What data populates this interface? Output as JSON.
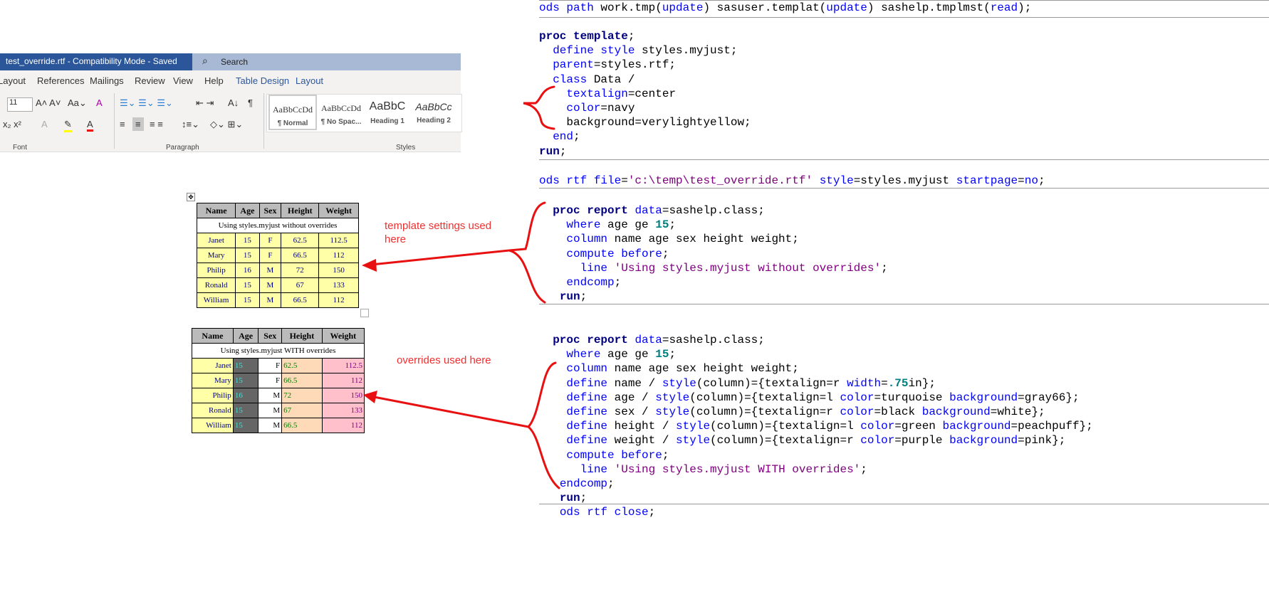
{
  "word": {
    "title": "test_override.rtf  -  Compatibility Mode  -  Saved",
    "search": "Search",
    "tabs": [
      "Layout",
      "References",
      "Mailings",
      "Review",
      "View",
      "Help",
      "Table Design",
      "Layout"
    ],
    "font_size": "11",
    "groups": [
      "Font",
      "Paragraph",
      "Styles"
    ],
    "styles": [
      {
        "preview": "AaBbCcDd",
        "name": "¶ Normal"
      },
      {
        "preview": "AaBbCcDd",
        "name": "¶ No Spac..."
      },
      {
        "preview": "AaBbC",
        "name": "Heading 1"
      },
      {
        "preview": "AaBbCc",
        "name": "Heading 2"
      }
    ]
  },
  "table1": {
    "headers": [
      "Name",
      "Age",
      "Sex",
      "Height",
      "Weight"
    ],
    "subtitle": "Using styles.myjust without overrides",
    "rows": [
      [
        "Janet",
        "15",
        "F",
        "62.5",
        "112.5"
      ],
      [
        "Mary",
        "15",
        "F",
        "66.5",
        "112"
      ],
      [
        "Philip",
        "16",
        "M",
        "72",
        "150"
      ],
      [
        "Ronald",
        "15",
        "M",
        "67",
        "133"
      ],
      [
        "William",
        "15",
        "M",
        "66.5",
        "112"
      ]
    ]
  },
  "table2": {
    "headers": [
      "Name",
      "Age",
      "Sex",
      "Height",
      "Weight"
    ],
    "subtitle": "Using styles.myjust WITH overrides",
    "rows": [
      [
        "Janet",
        "15",
        "F",
        "62.5",
        "112.5"
      ],
      [
        "Mary",
        "15",
        "F",
        "66.5",
        "112"
      ],
      [
        "Philip",
        "16",
        "M",
        "72",
        "150"
      ],
      [
        "Ronald",
        "15",
        "M",
        "67",
        "133"
      ],
      [
        "William",
        "15",
        "M",
        "66.5",
        "112"
      ]
    ]
  },
  "annotations": {
    "template": "template settings used\nhere",
    "overrides": "overrides used here"
  },
  "code": {
    "b1": [
      [
        [
          "ods path",
          "k"
        ],
        [
          " work.tmp(",
          ""
        ],
        [
          "update",
          "k"
        ],
        [
          ") sasuser.templat(",
          ""
        ],
        [
          "update",
          "k"
        ],
        [
          ") sashelp.tmplmst(",
          ""
        ],
        [
          "read",
          "k"
        ],
        [
          ");",
          ""
        ]
      ]
    ],
    "b2": [
      [
        [
          "proc template",
          "b"
        ],
        [
          ";",
          ""
        ]
      ],
      [
        [
          "  ",
          ""
        ],
        [
          "define style",
          "k"
        ],
        [
          " styles.myjust;",
          ""
        ]
      ],
      [
        [
          "  ",
          ""
        ],
        [
          "parent",
          "k"
        ],
        [
          "=styles.rtf;",
          ""
        ]
      ],
      [
        [
          "  ",
          ""
        ],
        [
          "class",
          "k"
        ],
        [
          " Data /",
          ""
        ]
      ],
      [
        [
          "    ",
          ""
        ],
        [
          "textalign",
          "k"
        ],
        [
          "=center",
          ""
        ]
      ],
      [
        [
          "    ",
          ""
        ],
        [
          "color",
          "k"
        ],
        [
          "=navy",
          ""
        ]
      ],
      [
        [
          "    background=verylightyellow;",
          ""
        ]
      ],
      [
        [
          "  ",
          ""
        ],
        [
          "end",
          "k"
        ],
        [
          ";",
          ""
        ]
      ],
      [
        [
          "run",
          "b"
        ],
        [
          ";",
          ""
        ]
      ]
    ],
    "b3": [
      [
        [
          "ods rtf file",
          "k"
        ],
        [
          "=",
          ""
        ],
        [
          "'c:\\temp\\test_override.rtf'",
          "s"
        ],
        [
          " ",
          ""
        ],
        [
          "style",
          "k"
        ],
        [
          "=styles.myjust ",
          ""
        ],
        [
          "startpage",
          "k"
        ],
        [
          "=",
          ""
        ],
        [
          "no",
          "k"
        ],
        [
          ";",
          ""
        ]
      ]
    ],
    "b4": [
      [
        [
          "  ",
          ""
        ],
        [
          "proc report",
          "b"
        ],
        [
          " ",
          ""
        ],
        [
          "data",
          "k"
        ],
        [
          "=sashelp.class;",
          ""
        ]
      ],
      [
        [
          "    ",
          ""
        ],
        [
          "where",
          "k"
        ],
        [
          " age ge ",
          ""
        ],
        [
          "15",
          "n"
        ],
        [
          ";",
          ""
        ]
      ],
      [
        [
          "    ",
          ""
        ],
        [
          "column",
          "k"
        ],
        [
          " name age sex height weight;",
          ""
        ]
      ],
      [
        [
          "    ",
          ""
        ],
        [
          "compute before",
          "k"
        ],
        [
          ";",
          ""
        ]
      ],
      [
        [
          "      ",
          ""
        ],
        [
          "line",
          "k"
        ],
        [
          " ",
          ""
        ],
        [
          "'Using styles.myjust without overrides'",
          "s"
        ],
        [
          ";",
          ""
        ]
      ],
      [
        [
          "    ",
          ""
        ],
        [
          "endcomp",
          "k"
        ],
        [
          ";",
          ""
        ]
      ],
      [
        [
          "   ",
          ""
        ],
        [
          "run",
          "b"
        ],
        [
          ";",
          ""
        ]
      ]
    ],
    "b5": [
      [
        [
          "  ",
          ""
        ],
        [
          "proc report",
          "b"
        ],
        [
          " ",
          ""
        ],
        [
          "data",
          "k"
        ],
        [
          "=sashelp.class;",
          ""
        ]
      ],
      [
        [
          "    ",
          ""
        ],
        [
          "where",
          "k"
        ],
        [
          " age ge ",
          ""
        ],
        [
          "15",
          "n"
        ],
        [
          ";",
          ""
        ]
      ],
      [
        [
          "    ",
          ""
        ],
        [
          "column",
          "k"
        ],
        [
          " name age sex height weight;",
          ""
        ]
      ],
      [
        [
          "    ",
          ""
        ],
        [
          "define",
          "k"
        ],
        [
          " name / ",
          ""
        ],
        [
          "style",
          "k"
        ],
        [
          "(column)={textalign=r ",
          ""
        ],
        [
          "width",
          "k"
        ],
        [
          "=",
          ""
        ],
        [
          ".75",
          "n"
        ],
        [
          "in};",
          ""
        ]
      ],
      [
        [
          "    ",
          ""
        ],
        [
          "define",
          "k"
        ],
        [
          " age / ",
          ""
        ],
        [
          "style",
          "k"
        ],
        [
          "(column)={textalign=l ",
          ""
        ],
        [
          "color",
          "k"
        ],
        [
          "=turquoise ",
          ""
        ],
        [
          "background",
          "k"
        ],
        [
          "=gray66};",
          ""
        ]
      ],
      [
        [
          "    ",
          ""
        ],
        [
          "define",
          "k"
        ],
        [
          " sex / ",
          ""
        ],
        [
          "style",
          "k"
        ],
        [
          "(column)={textalign=r ",
          ""
        ],
        [
          "color",
          "k"
        ],
        [
          "=black ",
          ""
        ],
        [
          "background",
          "k"
        ],
        [
          "=white};",
          ""
        ]
      ],
      [
        [
          "    ",
          ""
        ],
        [
          "define",
          "k"
        ],
        [
          " height / ",
          ""
        ],
        [
          "style",
          "k"
        ],
        [
          "(column)={textalign=l ",
          ""
        ],
        [
          "color",
          "k"
        ],
        [
          "=green ",
          ""
        ],
        [
          "background",
          "k"
        ],
        [
          "=peachpuff};",
          ""
        ]
      ],
      [
        [
          "    ",
          ""
        ],
        [
          "define",
          "k"
        ],
        [
          " weight / ",
          ""
        ],
        [
          "style",
          "k"
        ],
        [
          "(column)={textalign=r ",
          ""
        ],
        [
          "color",
          "k"
        ],
        [
          "=purple ",
          ""
        ],
        [
          "background",
          "k"
        ],
        [
          "=pink};",
          ""
        ]
      ],
      [
        [
          "    ",
          ""
        ],
        [
          "compute before",
          "k"
        ],
        [
          ";",
          ""
        ]
      ],
      [
        [
          "      ",
          ""
        ],
        [
          "line",
          "k"
        ],
        [
          " ",
          ""
        ],
        [
          "'Using styles.myjust WITH overrides'",
          "s"
        ],
        [
          ";",
          ""
        ]
      ],
      [
        [
          "   ",
          ""
        ],
        [
          "endcomp",
          "k"
        ],
        [
          ";",
          ""
        ]
      ],
      [
        [
          "   ",
          ""
        ],
        [
          "run",
          "b"
        ],
        [
          ";",
          ""
        ]
      ],
      [
        [
          "   ",
          ""
        ],
        [
          "ods rtf close",
          "k"
        ],
        [
          ";",
          ""
        ]
      ]
    ]
  }
}
